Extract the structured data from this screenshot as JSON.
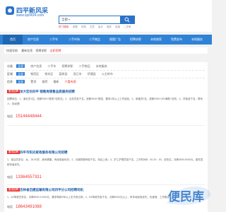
{
  "site": {
    "name": "四平新风采",
    "url": "www.sp0434.com",
    "brand_color": "#2a73c8"
  },
  "search": {
    "category": "全部",
    "placeholder": "",
    "button_icon": "search-icon"
  },
  "hot": {
    "label": "热门搜索:",
    "links": [
      "销售",
      "司机",
      "文员",
      "会计",
      "保安",
      "出租",
      "二手房"
    ]
  },
  "nav": {
    "items": [
      "首页",
      "房产信息",
      "二手车",
      "二手市场",
      "二手物品",
      "搜狐广告",
      "招聘求职",
      "本地商家",
      "免费发布",
      "本地服务"
    ],
    "active_index": 0,
    "color": "#2f82d6"
  },
  "breadcrumb": {
    "prefix": "快速导航:",
    "items": [
      "最新信息",
      "招聘求职"
    ],
    "current": "全职招聘"
  },
  "filters": {
    "row1": {
      "label": "分类",
      "items": [
        "全部",
        "房产信息",
        "二手车",
        "招聘求职",
        "二手物品",
        "本地服务"
      ]
    },
    "row2": {
      "label": "区域",
      "items": [
        "全部",
        "铁西区",
        "铁东区",
        "梨树县",
        "双辽市",
        "伊通县"
      ],
      "extra": "公主岭市"
    },
    "row3": {
      "label": "信息",
      "items": [
        "全部",
        "置顶",
        "推荐",
        "最新"
      ],
      "extra_red": "只看有图"
    }
  },
  "listings": [
    {
      "tag": "置顶招聘",
      "title": "龙大宏农四平 销售再销售品质服务招聘",
      "body": "招聘岗位：1、营业员1名，底薪2500+提成+包吃住；2、业务员若干名，底薪3000+提成，要求1年以上工作经验。3、库管员2名，底薪2000+200满勤+包吃。4、学徒若干名。联系人：张经理",
      "phone_label": "电话",
      "phone": "15144448444."
    },
    {
      "tag": "置顶招聘",
      "title": "四平市阳光家政服务有限公司招聘",
      "body": "1、保洁员多名：女，25-50岁，身体健康，有经验者优先；2、月嫂育婴师若干名，持证上岗；3、护工护理员若干名，工作时间8：00-20：00，包吃住，月薪3500-6000元，能吃苦耐劳者优先。",
      "phone_label": "电话",
      "phone": "13364557331"
    },
    {
      "tag": "置顶招聘",
      "title": "吉林省迅捷运输有限公司四平分公司招聘司机",
      "body": "1、A2驾驶员多名，月薪8000-12000元，要求驾龄3年以上无不良记录；2、B2驾驶员若干名，月薪6000元以上，有本地经验优先，包食宿，工作稳定。",
      "phone_label": "电话",
      "phone": "18643491088"
    }
  ],
  "watermark": {
    "text": "便民库"
  }
}
